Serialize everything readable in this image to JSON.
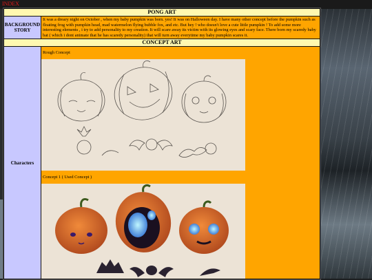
{
  "index_link": "INDEX",
  "header": {
    "title": "PONG ART"
  },
  "background_story": {
    "label": "BACKGROUND STORY",
    "text": "It was a dreary night on October , when my baby pumpkin was born. yes! It was on Halloween day. I have many other concept before the pumpkin such as floating frog with pumpkin head, mad watermelon flying bubble fox, and etc. But hey ! who doesn't love a cute little pumpkin ! To add some more interesting elements , i try to add personality to my creation. It will scare away its victim with its glowing eyes and scary face. There born my scaredy baby bat ( which i dont animate that he has scaredy personality) that will turn away everytime my baby pumpkin scares it."
  },
  "concept_art": {
    "title": "CONCEPT ART",
    "label": "Characters",
    "items": [
      {
        "caption": "Rough Concept"
      },
      {
        "caption": "Concept 1 ( Used Concept )"
      }
    ]
  },
  "colors": {
    "orange": "#ffa500",
    "header_yellow": "#fff8b0",
    "label_lavender": "#c8c8ff",
    "link_red": "#e01818"
  }
}
